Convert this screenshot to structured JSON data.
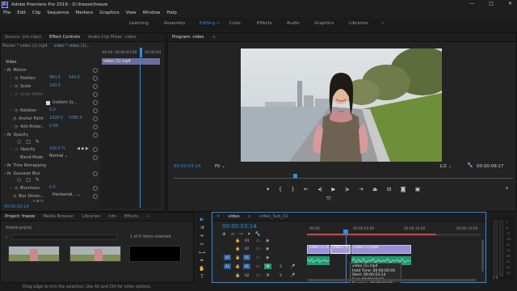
{
  "window": {
    "title": "Adobe Premiere Pro 2019 - D:\\freeze\\freeze",
    "controls": [
      "—",
      "□",
      "✕"
    ]
  },
  "menu": [
    "File",
    "Edit",
    "Clip",
    "Sequence",
    "Markers",
    "Graphics",
    "View",
    "Window",
    "Help"
  ],
  "workspaces": {
    "items": [
      "Learning",
      "Assembly",
      "Editing",
      "Color",
      "Effects",
      "Audio",
      "Graphics",
      "Libraries"
    ],
    "active": "Editing"
  },
  "effect_controls": {
    "tabs": [
      "Source: (no clips)",
      "Effect Controls",
      "Audio Clip Mixer: video"
    ],
    "master": "Master * video (1).mp4",
    "clip": "video * video (1)...",
    "time_start": ":00:00",
    "time_mid": "00:00:03:00",
    "time_end": "00:00:04",
    "clip_label": "video (1).mp4",
    "section": "Video",
    "rows": {
      "motion": "Motion",
      "position": "Position",
      "position_x": "960.0",
      "position_y": "540.0",
      "scale": "Scale",
      "scale_val": "100.0",
      "scale_width": "Scale Width",
      "uniform_scale": "Uniform Sc...",
      "rotation": "Rotation",
      "rotation_val": "0.0",
      "anchor": "Anchor Point",
      "anchor_x": "1920.0",
      "anchor_y": "1080.0",
      "antiflicker": "Anti-flicker...",
      "antiflicker_val": "0.00",
      "opacity_group": "Opacity",
      "opacity": "Opacity",
      "opacity_val": "100.0 %",
      "blend": "Blend Mode",
      "blend_val": "Normal",
      "time_remap": "Time Remapping",
      "gaussian": "Gaussian Blur",
      "blurriness": "Blurriness",
      "blurriness_val": "0.0",
      "blur_dims": "Blur Dimen...",
      "blur_dims_val": "Horizontal..."
    },
    "footer_time": "00:00:03:14"
  },
  "program": {
    "tab": "Program: video",
    "timecode": "00:00:03:14",
    "fit": "Fit",
    "quality": "1/2",
    "duration": "00:00:09:17"
  },
  "project": {
    "tabs": [
      "Project: freeze",
      "Media Browser",
      "Libraries",
      "Info",
      "Effects"
    ],
    "file": "freeze.prproj",
    "selection": "1 of 6 items selected"
  },
  "timeline": {
    "tabs": [
      "video",
      "video_Sub_01"
    ],
    "timecode": "00:00:03:14",
    "ruler": [
      ":00:00",
      "00:00:05:00",
      "00:00:10:00",
      "00:00:15:00"
    ],
    "tracks": [
      "V3",
      "V2",
      "V1",
      "A1",
      "A2"
    ],
    "clips": {
      "v1_a": "video (1).mp4",
      "v1_b": "video (1)",
      "v1_c": "video (1).mp4"
    },
    "tooltip": {
      "name": "video (1).mp4",
      "hold": "Hold Time: 00:00:00:00",
      "start": "Start: 00:00:03:14",
      "end": "End: 00:00:04:03",
      "duration": "Duration: 00:00:02:00"
    }
  },
  "status": "Drag edge to trim the selection. Use Alt and Ctrl for other options.",
  "colors": {
    "accent": "#2d8ceb",
    "clip_video": "#9b8fd8",
    "clip_audio": "#1e9b73"
  }
}
